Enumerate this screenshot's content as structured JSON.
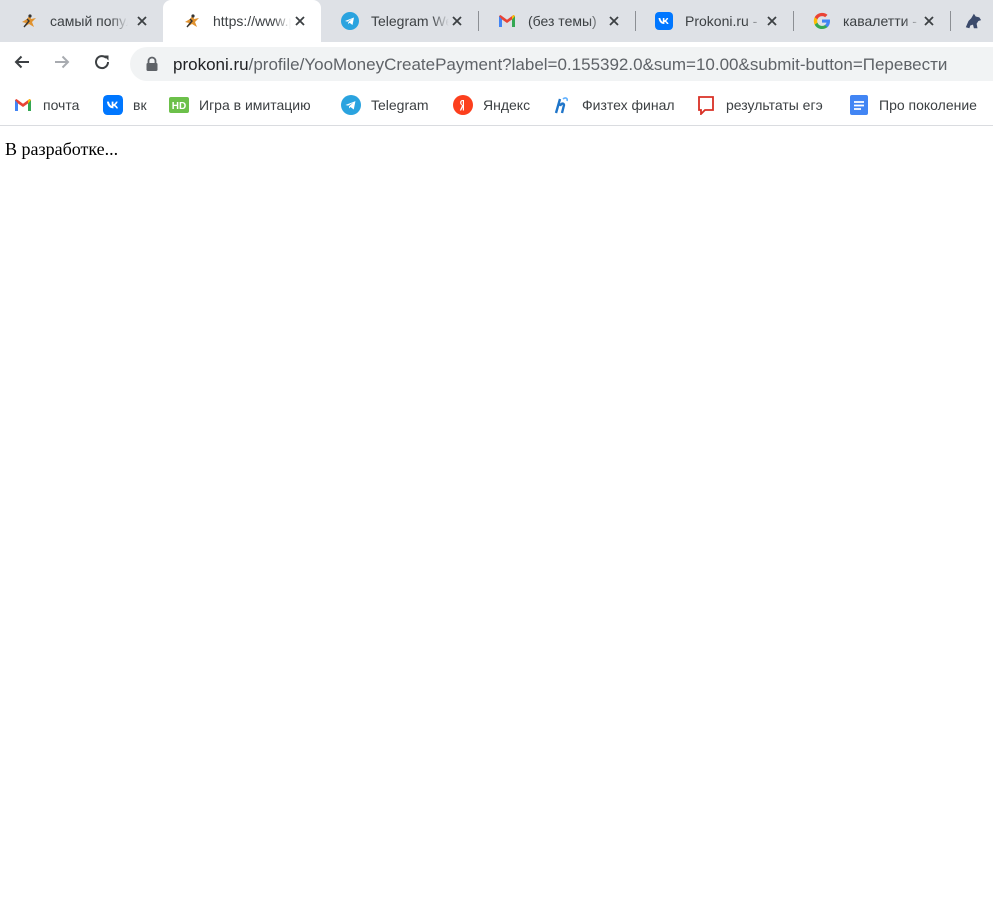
{
  "browser": {
    "tabs": [
      {
        "title": "самый популярный",
        "icon": "prokoni-horse-favicon",
        "active": false
      },
      {
        "title": "https://www.prokoni.ru",
        "icon": "prokoni-horse-favicon",
        "active": true
      },
      {
        "title": "Telegram Web",
        "icon": "telegram-favicon",
        "active": false
      },
      {
        "title": "(без темы)",
        "icon": "gmail-favicon",
        "active": false
      },
      {
        "title": "Prokoni.ru - ",
        "icon": "vk-favicon",
        "active": false
      },
      {
        "title": "кавалетти - ",
        "icon": "google-favicon",
        "active": false
      }
    ],
    "overflow_tab_icon": "horse-silhouette-favicon",
    "address": {
      "host": "prokoni.ru",
      "path": "/profile/YooMoneyCreatePayment?label=0.155392.0&sum=10.00&submit-button=Перевести"
    },
    "bookmarks": [
      {
        "label": "почта",
        "icon": "gmail-icon"
      },
      {
        "label": "вк",
        "icon": "vk-icon"
      },
      {
        "label": "Игра в имитацию",
        "icon": "hd-icon"
      },
      {
        "label": "Telegram",
        "icon": "telegram-icon"
      },
      {
        "label": "Яндекс",
        "icon": "yandex-icon"
      },
      {
        "label": "Физтех финал",
        "icon": "phystech-icon"
      },
      {
        "label": "результаты егэ",
        "icon": "speech-bubble-icon"
      },
      {
        "label": "Про поколение",
        "icon": "google-docs-icon"
      }
    ]
  },
  "page": {
    "message": "В разработке..."
  },
  "colors": {
    "tabstrip_bg": "#dee1e6",
    "omnibox_bg": "#f1f3f4",
    "text": "#3c4043",
    "telegram_blue": "#2aa3df",
    "vk_blue": "#0077ff",
    "yandex_red": "#fc3f1d",
    "hd_green": "#6cc04a"
  }
}
